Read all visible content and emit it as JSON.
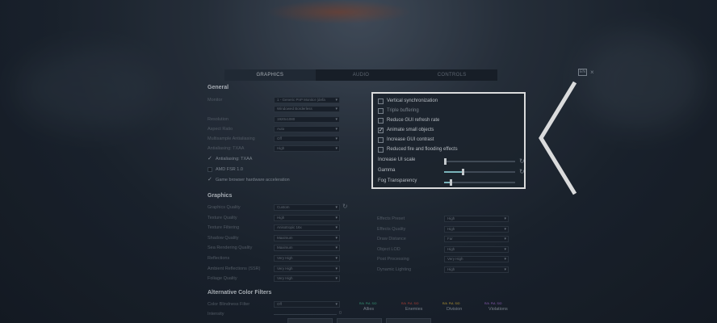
{
  "tabs": [
    {
      "label": "GRAPHICS",
      "active": true
    },
    {
      "label": "AUDIO",
      "active": false
    },
    {
      "label": "CONTROLS",
      "active": false
    }
  ],
  "top_right": {
    "badge": "EN",
    "close": "×"
  },
  "general": {
    "title": "General",
    "labels": {
      "monitor": "Monitor",
      "resolution": "Resolution",
      "aspect_ratio": "Aspect Ratio",
      "multisample": "Multisample Antialiasing",
      "antialiasing_txaa": "Antialiasing: TXAA"
    },
    "values": {
      "monitor": "1 - Generic PnP Monitor (defa",
      "display_mode": "Windowed Borderless",
      "resolution": "1920x1080",
      "aspect_ratio": "Auto",
      "multisample": "Off",
      "antialiasing_txaa": "High"
    },
    "checks": [
      {
        "label": "Antialiasing: TXAA",
        "checked": true
      },
      {
        "label": "AMD FSR 1.0",
        "checked": false
      },
      {
        "label": "Game browser hardware acceleration",
        "checked": true
      }
    ]
  },
  "panel": {
    "options": [
      {
        "label": "Vertical synchronization",
        "checked": false,
        "dim": false
      },
      {
        "label": "Triple buffering",
        "checked": false,
        "dim": true
      },
      {
        "label": "Reduce GUI refresh rate",
        "checked": false,
        "dim": false
      },
      {
        "label": "Animate small objects",
        "checked": true,
        "dim": false
      },
      {
        "label": "Increase GUI contrast",
        "checked": false,
        "dim": false
      },
      {
        "label": "Reduced fire and flooding effects",
        "checked": false,
        "dim": false
      }
    ],
    "sliders": [
      {
        "label": "Increase UI scale",
        "value": 0.0,
        "reset": true
      },
      {
        "label": "Gamma",
        "value": 0.25,
        "reset": true
      },
      {
        "label": "Fog Transparency",
        "value": 0.08,
        "reset": false
      }
    ]
  },
  "graphics": {
    "title": "Graphics",
    "left_labels": [
      "Graphics Quality",
      "Texture Quality",
      "Texture Filtering",
      "Shadow Quality",
      "Sea Rendering Quality",
      "Reflections",
      "Ambient Reflections (SSR)",
      "Foliage Quality"
    ],
    "left_values": [
      "Custom",
      "High",
      "Anisotropic 16x",
      "Maximum",
      "Maximum",
      "Very High",
      "Very High",
      "Very High"
    ],
    "right_labels": [
      "Effects Preset",
      "Effects Quality",
      "Draw Distance",
      "Object LOD",
      "Post Processing",
      "Dynamic Lighting"
    ],
    "right_values": [
      "High",
      "High",
      "Far",
      "High",
      "Very High",
      "High"
    ]
  },
  "color_filters": {
    "title": "Alternative Color Filters",
    "blindness_label": "Color Blindness Filter",
    "blindness_value": "Off",
    "intensity_label": "Intensity",
    "intensity_value": "0",
    "groups": [
      {
        "name": "Allies",
        "codes": [
          "R/A",
          "P/A",
          "S/O"
        ],
        "color": "#3fb48a"
      },
      {
        "name": "Enemies",
        "codes": [
          "R/A",
          "P/A",
          "S/O"
        ],
        "color": "#d14a3d"
      },
      {
        "name": "Division",
        "codes": [
          "R/A",
          "P/A",
          "S/O"
        ],
        "color": "#d8b23a"
      },
      {
        "name": "Violations",
        "codes": [
          "R/A",
          "P/A",
          "S/O"
        ],
        "color": "#a46ad1"
      }
    ]
  }
}
